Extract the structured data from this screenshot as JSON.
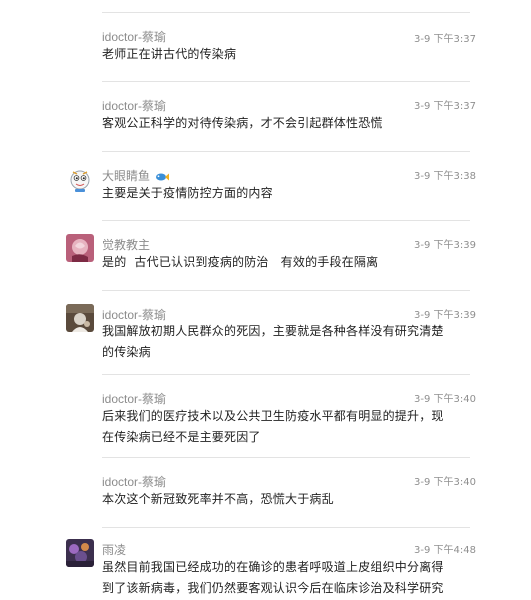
{
  "messages": [
    {
      "name": "idoctor-蔡瑜",
      "time": "3-9 下午3:37",
      "text": "老师正在讲古代的传染病"
    },
    {
      "name": "idoctor-蔡瑜",
      "time": "3-9 下午3:37",
      "text": "客观公正科学的对待传染病，才不会引起群体性恐慌"
    },
    {
      "name": "大眼睛鱼",
      "time": "3-9 下午3:38",
      "text": "主要是关于疫情防控方面的内容"
    },
    {
      "name": "觉教教主",
      "time": "3-9 下午3:39",
      "text": "是的  古代已认识到疫病的防治   有效的手段在隔离"
    },
    {
      "name": "idoctor-蔡瑜",
      "time": "3-9 下午3:39",
      "text": "我国解放初期人民群众的死因，主要就是各种各样没有研究清楚的传染病"
    },
    {
      "name": "idoctor-蔡瑜",
      "time": "3-9 下午3:40",
      "text": "后来我们的医疗技术以及公共卫生防疫水平都有明显的提升，现在传染病已经不是主要死因了"
    },
    {
      "name": "idoctor-蔡瑜",
      "time": "3-9 下午3:40",
      "text": "本次这个新冠致死率并不高，恐慌大于病乱"
    },
    {
      "name": "雨凌",
      "time": "3-9 下午4:48",
      "text": "虽然目前我国已经成功的在确诊的患者呼吸道上皮组织中分离得到了该新病毒，我们仍然要客观认识今后在临床诊治及科学研究"
    }
  ]
}
